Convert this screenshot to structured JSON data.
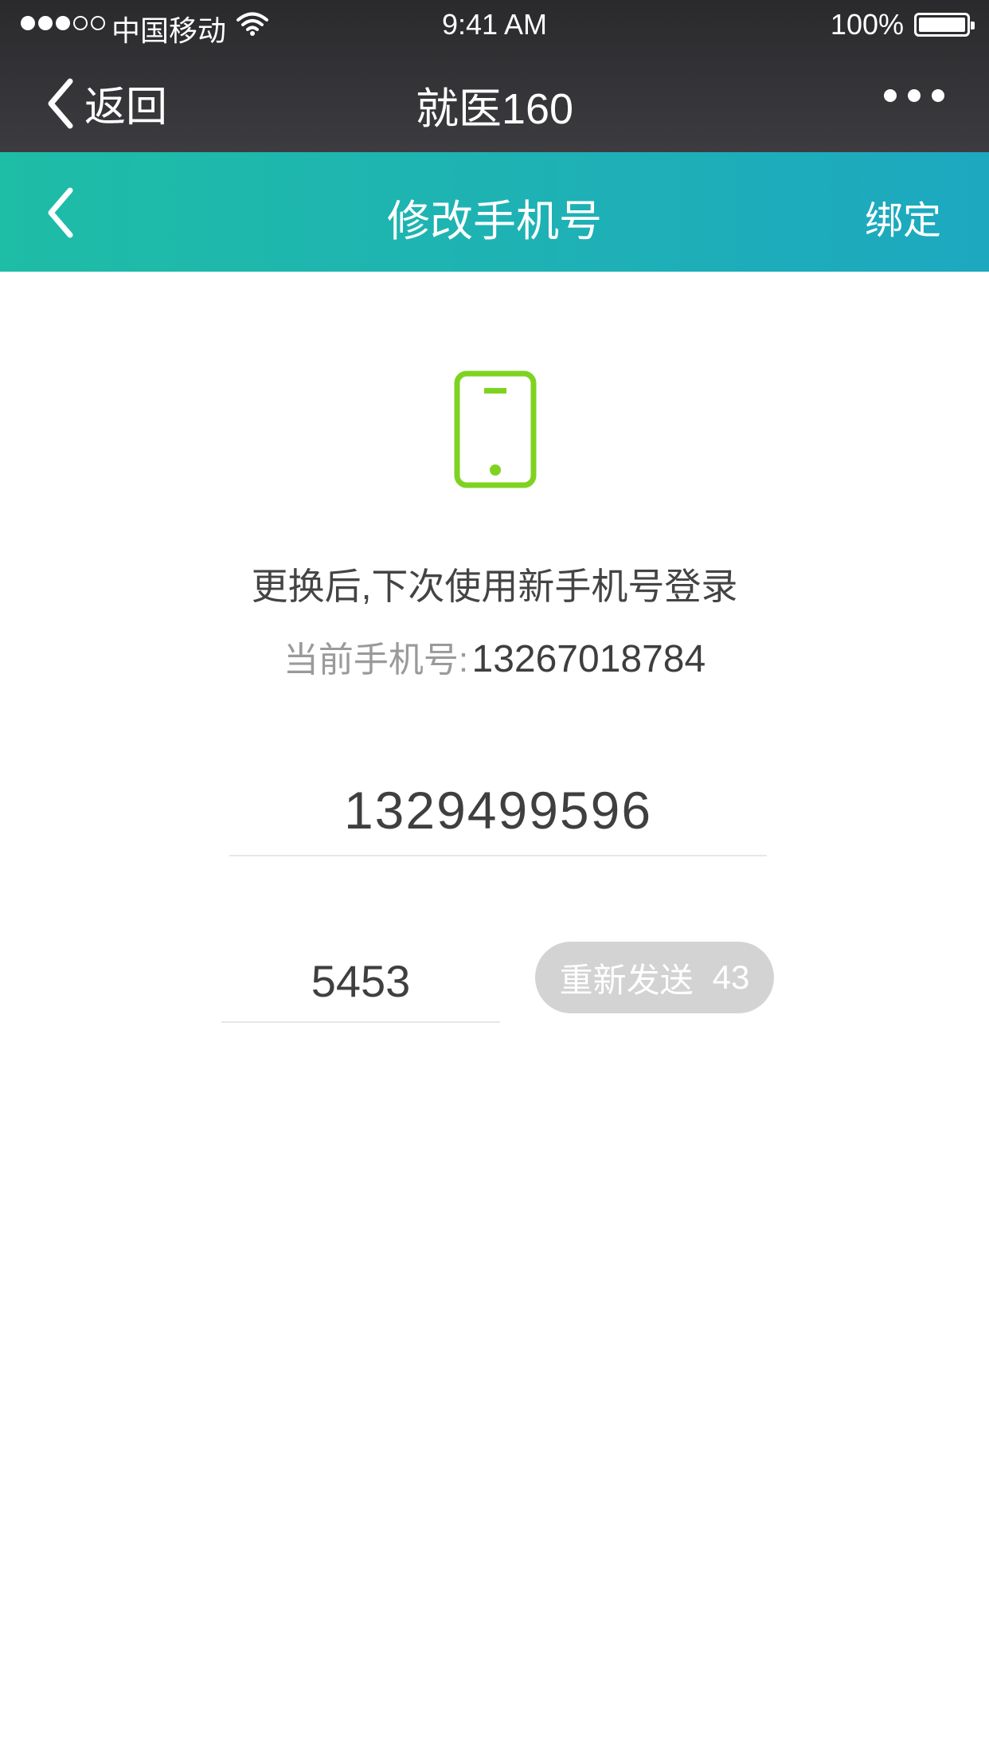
{
  "status_bar": {
    "carrier": "中国移动",
    "time": "9:41 AM",
    "battery": "100%",
    "signal_icon": "signal-dots-icon",
    "wifi_icon": "wifi-icon",
    "battery_icon": "battery-icon"
  },
  "wechat_nav": {
    "back_label": "返回",
    "title": "就医160",
    "more_icon": "more-dots-icon"
  },
  "header": {
    "title": "修改手机号",
    "action": "绑定",
    "back_icon": "chevron-left-icon",
    "gradient_start": "#1ebda6",
    "gradient_end": "#1da8c0"
  },
  "main": {
    "icon": "smartphone-icon",
    "icon_color": "#7ed321",
    "hint": "更换后,下次使用新手机号登录",
    "current_label": "当前手机号:",
    "current_number": "13267018784",
    "new_phone_value": "1329499596",
    "code_value": "5453",
    "resend_label": "重新发送",
    "resend_countdown": "43"
  }
}
